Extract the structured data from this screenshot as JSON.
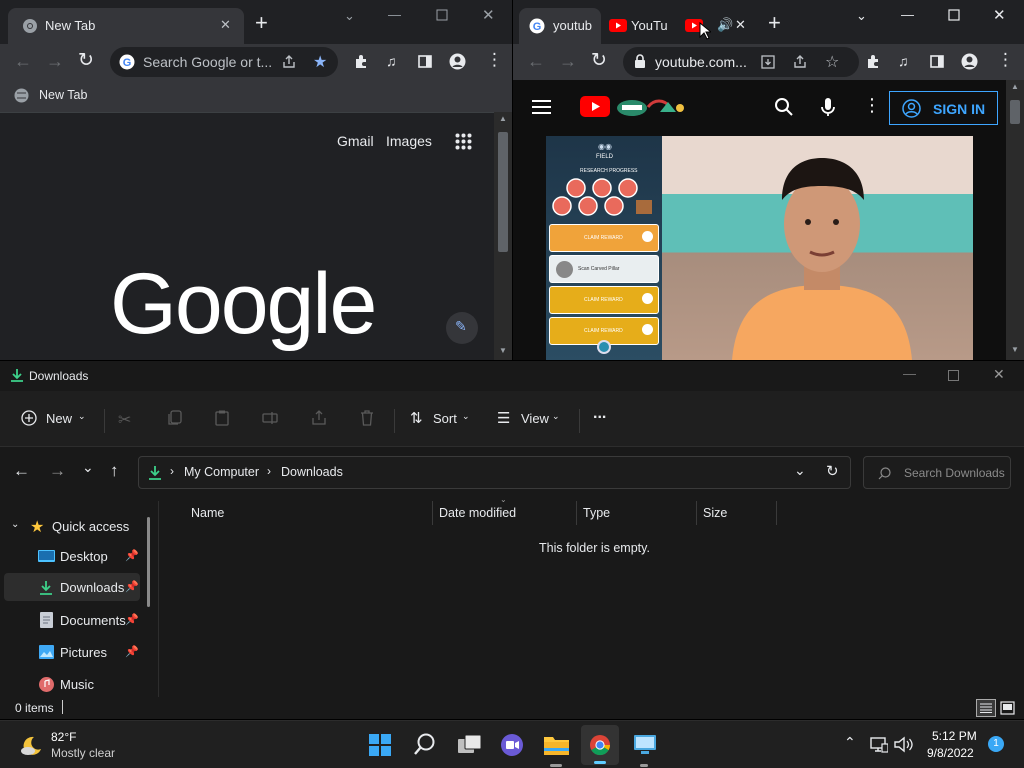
{
  "left_browser": {
    "tab_title": "New Tab",
    "omnibox_placeholder": "Search Google or t...",
    "bookmark": "New Tab",
    "ntp_links": [
      "Gmail",
      "Images"
    ],
    "logo_text": "Google"
  },
  "right_browser": {
    "tabs": [
      "youtub",
      "YouTu",
      ""
    ],
    "url": "youtube.com...",
    "sign_in_label": "SIGN IN",
    "video_game": {
      "tabs": [
        "FIELD"
      ],
      "header": "RESEARCH PROGRESS",
      "rows": [
        "CLAIM REWARD",
        "Scan Carved Pillar",
        "CLAIM REWARD",
        "CLAIM REWARD"
      ]
    }
  },
  "explorer": {
    "title": "Downloads",
    "commands": {
      "new": "New",
      "sort": "Sort",
      "view": "View",
      "more": "..."
    },
    "breadcrumb": [
      "My Computer",
      "Downloads"
    ],
    "search_placeholder": "Search Downloads",
    "nav": {
      "quick_access": "Quick access",
      "items": [
        {
          "label": "Desktop",
          "pinned": true
        },
        {
          "label": "Downloads",
          "pinned": true
        },
        {
          "label": "Documents",
          "pinned": true
        },
        {
          "label": "Pictures",
          "pinned": true
        },
        {
          "label": "Music",
          "pinned": false
        }
      ]
    },
    "columns": [
      "Name",
      "Date modified",
      "Type",
      "Size"
    ],
    "empty_message": "This folder is empty.",
    "status": "0 items"
  },
  "taskbar": {
    "weather_temp": "82°F",
    "weather_desc": "Mostly clear",
    "time": "5:12 PM",
    "date": "9/8/2022",
    "notification_count": "1"
  },
  "colors": {
    "accent_blue": "#3ea6ff",
    "star_blue": "#8ab4f8",
    "folder_yellow": "#ffc83d",
    "youtube_red": "#ff0000"
  }
}
